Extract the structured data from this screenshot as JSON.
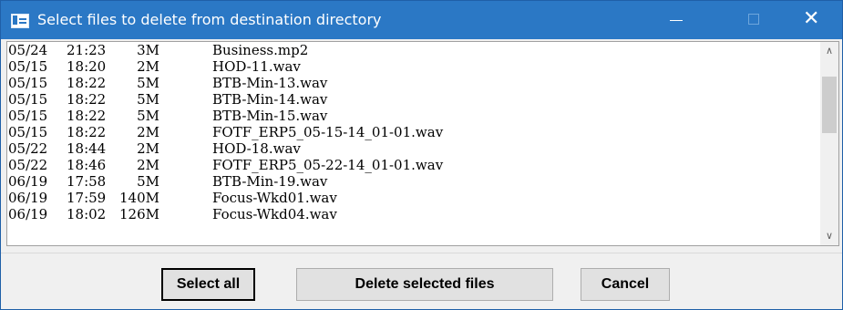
{
  "window": {
    "title": "Select files to delete from destination directory",
    "controls": {
      "minimize": "—",
      "close": "✕"
    }
  },
  "files": [
    {
      "date": "05/24",
      "time": "21:23",
      "size": "3M",
      "name": "Business.mp2"
    },
    {
      "date": "05/15",
      "time": "18:20",
      "size": "2M",
      "name": "HOD-11.wav"
    },
    {
      "date": "05/15",
      "time": "18:22",
      "size": "5M",
      "name": "BTB-Min-13.wav"
    },
    {
      "date": "05/15",
      "time": "18:22",
      "size": "5M",
      "name": "BTB-Min-14.wav"
    },
    {
      "date": "05/15",
      "time": "18:22",
      "size": "5M",
      "name": "BTB-Min-15.wav"
    },
    {
      "date": "05/15",
      "time": "18:22",
      "size": "2M",
      "name": "FOTF_ERP5_05-15-14_01-01.wav"
    },
    {
      "date": "05/22",
      "time": "18:44",
      "size": "2M",
      "name": "HOD-18.wav"
    },
    {
      "date": "05/22",
      "time": "18:46",
      "size": "2M",
      "name": "FOTF_ERP5_05-22-14_01-01.wav"
    },
    {
      "date": "06/19",
      "time": "17:58",
      "size": "5M",
      "name": "BTB-Min-19.wav"
    },
    {
      "date": "06/19",
      "time": "17:59",
      "size": "140M",
      "name": "Focus-Wkd01.wav"
    },
    {
      "date": "06/19",
      "time": "18:02",
      "size": "126M",
      "name": "Focus-Wkd04.wav"
    }
  ],
  "scroll_position": 0.15,
  "buttons": {
    "select_all": "Select all",
    "delete_selected": "Delete selected files",
    "cancel": "Cancel"
  },
  "colors": {
    "titlebar": "#2b78c5",
    "list_background": "#ffffff",
    "dialog_background": "#f0f0f0"
  }
}
